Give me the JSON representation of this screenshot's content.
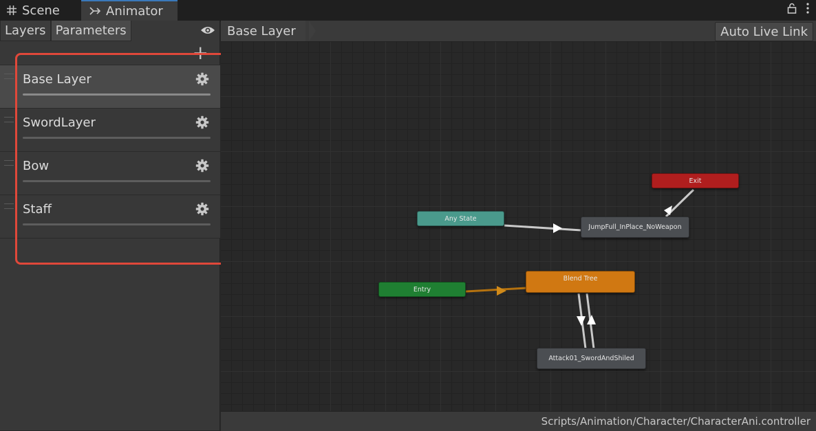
{
  "tabs": [
    {
      "label": "Scene",
      "icon": "grid-icon"
    },
    {
      "label": "Animator",
      "icon": "animator-icon"
    }
  ],
  "left_panel": {
    "tabs": [
      "Layers",
      "Parameters"
    ],
    "active_tab": "Parameters",
    "layers": [
      {
        "name": "Base Layer",
        "selected": true
      },
      {
        "name": "SwordLayer"
      },
      {
        "name": "Bow"
      },
      {
        "name": "Staff"
      }
    ]
  },
  "graph": {
    "breadcrumb": "Base Layer",
    "auto_live_link": "Auto Live Link",
    "nodes": {
      "exit": "Exit",
      "any_state": "Any State",
      "jump": "JumpFull_InPlace_NoWeapon",
      "entry": "Entry",
      "blend_tree": "Blend Tree",
      "attack": "Attack01_SwordAndShiled"
    }
  },
  "footer": {
    "path": "Scripts/Animation/Character/CharacterAni.controller"
  },
  "colors": {
    "highlight": "#e0483a",
    "exit": "#b01e1e",
    "any_state": "#4a9a8c",
    "entry": "#1f7f32",
    "blend_tree": "#d07812",
    "state": "#4b4e52",
    "tab_accent": "#3a79bb"
  }
}
